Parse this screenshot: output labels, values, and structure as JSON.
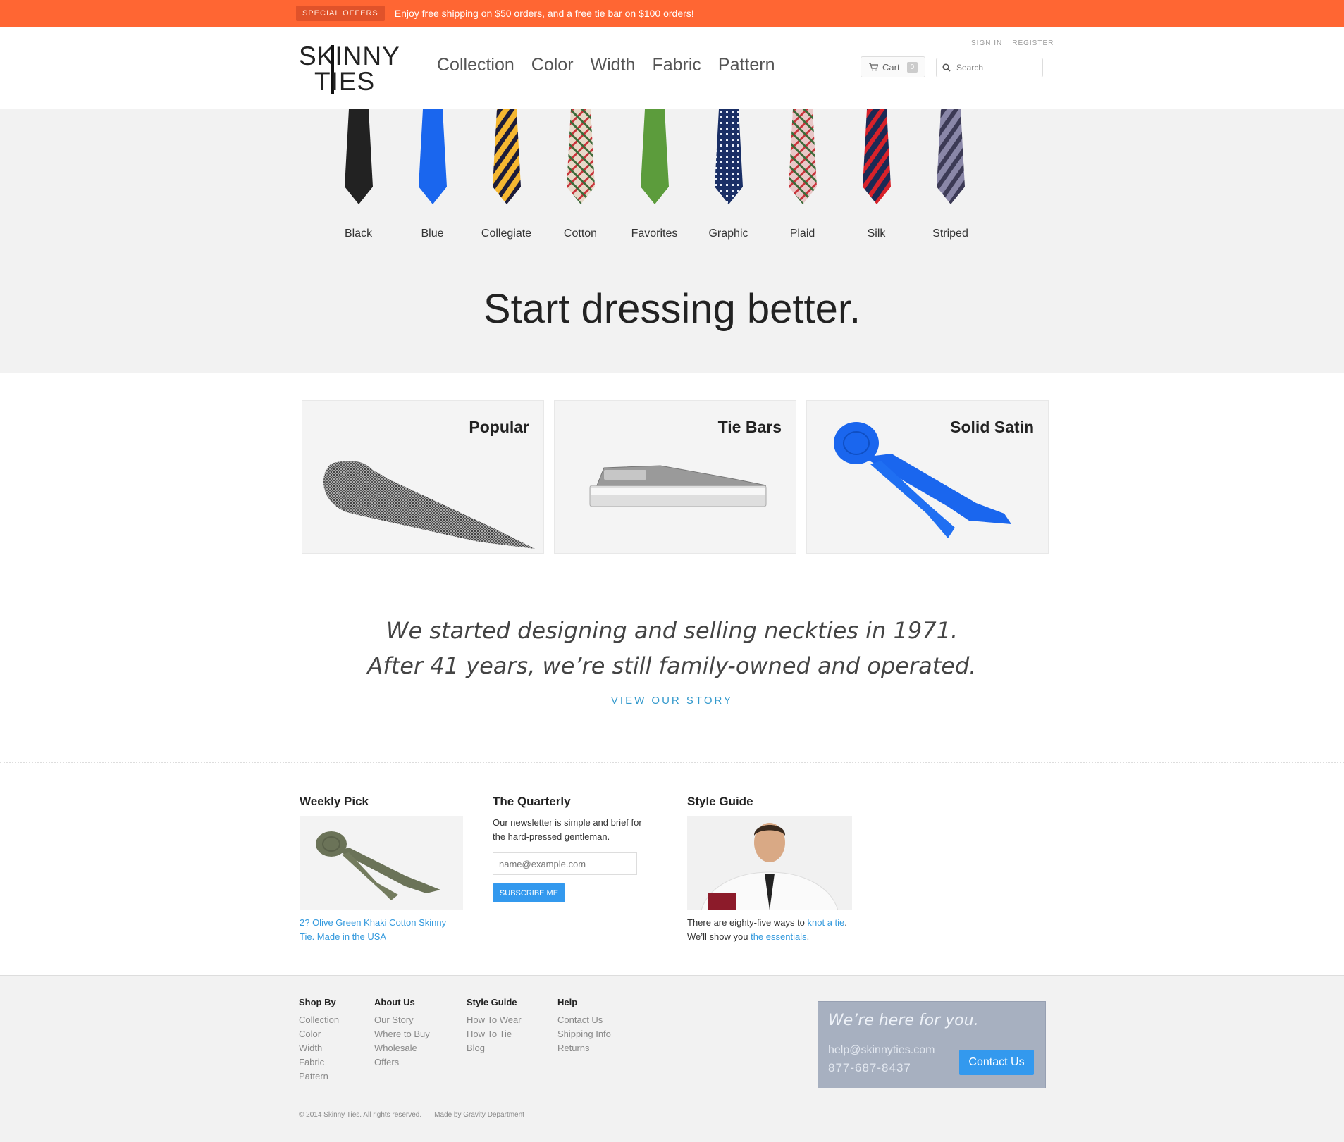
{
  "promo": {
    "badge": "SPECIAL OFFERS",
    "text": "Enjoy free shipping on $50 orders, and a free tie bar on $100 orders!",
    "bg_color": "#ff6633"
  },
  "header": {
    "logo_line1": "SKINNY",
    "logo_line2": "TIES",
    "nav": [
      "Collection",
      "Color",
      "Width",
      "Fabric",
      "Pattern"
    ],
    "sign_in": "SIGN IN",
    "register": "REGISTER",
    "cart_label": "Cart",
    "cart_count": "0",
    "search_placeholder": "Search"
  },
  "ties": [
    {
      "label": "Black",
      "color": "#222222",
      "pattern": "solid"
    },
    {
      "label": "Blue",
      "color": "#1a66ee",
      "pattern": "solid"
    },
    {
      "label": "Collegiate",
      "color": "#f5b731",
      "pattern": "stripe"
    },
    {
      "label": "Cotton",
      "color": "#e8d8c8",
      "pattern": "plaid"
    },
    {
      "label": "Favorites",
      "color": "#5c9c3c",
      "pattern": "solid"
    },
    {
      "label": "Graphic",
      "color": "#1a2f66",
      "pattern": "dots"
    },
    {
      "label": "Plaid",
      "color": "#e9c7c7",
      "pattern": "plaid"
    },
    {
      "label": "Silk",
      "color": "#1b2a55",
      "pattern": "stripe-red"
    },
    {
      "label": "Striped",
      "color": "#8a87a8",
      "pattern": "stripe-gray"
    }
  ],
  "tagline": "Start dressing better.",
  "categories": [
    "Popular",
    "Tie Bars",
    "Solid Satin"
  ],
  "story": {
    "line1": "We started designing and selling neckties in 1971.",
    "line2": "After 41 years, we’re still family-owned and operated.",
    "link": "VIEW OUR STORY"
  },
  "weekly_pick": {
    "title": "Weekly Pick",
    "link_text": "2? Olive Green Khaki Cotton Skinny Tie. Made in the USA"
  },
  "quarterly": {
    "title": "The Quarterly",
    "desc": "Our newsletter is simple and brief for the hard-pressed gentleman.",
    "email_placeholder": "name@example.com",
    "button": "SUBSCRIBE ME"
  },
  "style_guide": {
    "title": "Style Guide",
    "text1": "There are eighty-five ways to ",
    "link1": "knot a tie",
    "text2": ". We’ll show you ",
    "link2": "the essentials",
    "text3": "."
  },
  "footer": {
    "columns": [
      {
        "title": "Shop By",
        "items": [
          "Collection",
          "Color",
          "Width",
          "Fabric",
          "Pattern"
        ]
      },
      {
        "title": "About Us",
        "items": [
          "Our Story",
          "Where to Buy",
          "Wholesale",
          "Offers"
        ]
      },
      {
        "title": "Style Guide",
        "items": [
          "How To Wear",
          "How To Tie",
          "Blog"
        ]
      },
      {
        "title": "Help",
        "items": [
          "Contact Us",
          "Shipping Info",
          "Returns"
        ]
      }
    ],
    "contact_title": "We’re here for you.",
    "contact_email": "help@skinnyties.com",
    "contact_phone": "877-687-8437",
    "contact_button": "Contact Us",
    "copyright": "© 2014 Skinny Ties. All rights reserved.",
    "made_by": "Made by Gravity Department"
  }
}
